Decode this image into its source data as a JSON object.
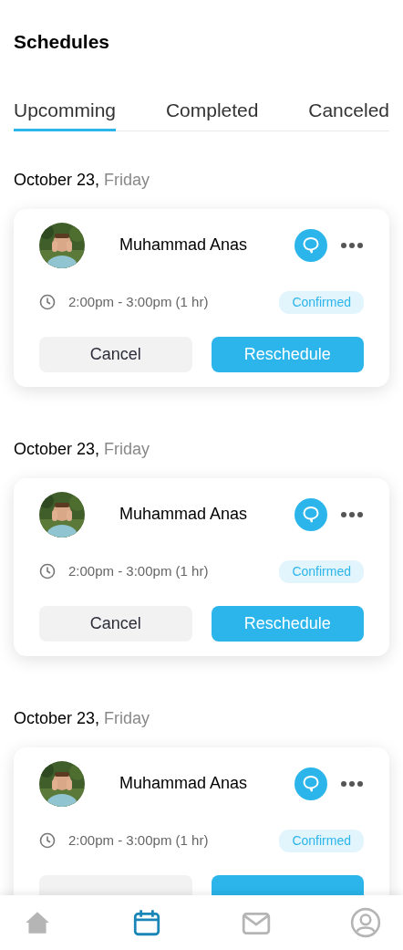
{
  "title": "Schedules",
  "tabs": [
    {
      "label": "Upcomming",
      "selected": true
    },
    {
      "label": "Completed",
      "selected": false
    },
    {
      "label": "Canceled",
      "selected": false
    }
  ],
  "appointments": [
    {
      "date": "October 23,",
      "weekday": "Friday",
      "name": "Muhammad Anas",
      "time": "2:00pm - 3:00pm (1 hr)",
      "status": "Confirmed",
      "cancel": "Cancel",
      "reschedule": "Reschedule"
    },
    {
      "date": "October 23,",
      "weekday": "Friday",
      "name": "Muhammad Anas",
      "time": "2:00pm - 3:00pm (1 hr)",
      "status": "Confirmed",
      "cancel": "Cancel",
      "reschedule": "Reschedule"
    },
    {
      "date": "October 23,",
      "weekday": "Friday",
      "name": "Muhammad Anas",
      "time": "2:00pm - 3:00pm (1 hr)",
      "status": "Confirmed"
    }
  ],
  "nav": [
    {
      "kind": "home",
      "selected": false
    },
    {
      "kind": "calendar",
      "selected": true
    },
    {
      "kind": "mail",
      "selected": false
    },
    {
      "kind": "profile",
      "selected": false
    }
  ]
}
